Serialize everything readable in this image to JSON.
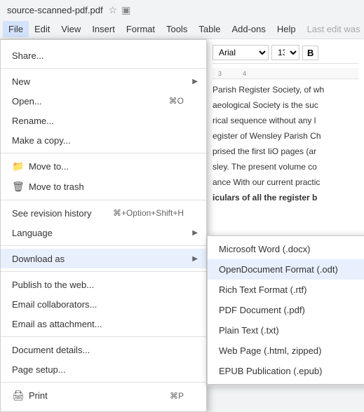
{
  "titleBar": {
    "filename": "source-scanned-pdf.pdf",
    "starIcon": "☆",
    "folderIcon": "▣"
  },
  "menuBar": {
    "items": [
      {
        "label": "File",
        "active": true
      },
      {
        "label": "Edit",
        "active": false
      },
      {
        "label": "View",
        "active": false
      },
      {
        "label": "Insert",
        "active": false
      },
      {
        "label": "Format",
        "active": false
      },
      {
        "label": "Tools",
        "active": false
      },
      {
        "label": "Table",
        "active": false
      },
      {
        "label": "Add-ons",
        "active": false
      },
      {
        "label": "Help",
        "active": false
      },
      {
        "label": "Last edit was",
        "active": false,
        "disabled": true
      }
    ]
  },
  "fileMenu": {
    "sections": [
      {
        "items": [
          {
            "label": "Share...",
            "shortcut": ""
          }
        ]
      },
      {
        "items": [
          {
            "label": "New",
            "hasArrow": true
          },
          {
            "label": "Open...",
            "shortcut": "⌘O"
          },
          {
            "label": "Rename..."
          },
          {
            "label": "Make a copy..."
          }
        ]
      },
      {
        "items": [
          {
            "label": "Move to...",
            "icon": "folder"
          },
          {
            "label": "Move to trash",
            "icon": "trash"
          }
        ]
      },
      {
        "items": [
          {
            "label": "See revision history",
            "shortcut": "⌘+Option+Shift+H"
          },
          {
            "label": "Language",
            "hasArrow": true
          }
        ]
      },
      {
        "items": [
          {
            "label": "Download as",
            "hasArrow": true,
            "highlighted": true
          }
        ]
      },
      {
        "items": [
          {
            "label": "Publish to the web..."
          },
          {
            "label": "Email collaborators..."
          },
          {
            "label": "Email as attachment..."
          }
        ]
      },
      {
        "items": [
          {
            "label": "Document details..."
          },
          {
            "label": "Page setup..."
          }
        ]
      },
      {
        "items": [
          {
            "label": "Print",
            "icon": "print",
            "shortcut": "⌘P"
          }
        ]
      }
    ]
  },
  "downloadSubmenu": {
    "items": [
      {
        "label": "Microsoft Word (.docx)"
      },
      {
        "label": "OpenDocument Format (.odt)",
        "highlighted": true
      },
      {
        "label": "Rich Text Format (.rtf)"
      },
      {
        "label": "PDF Document (.pdf)"
      },
      {
        "label": "Plain Text (.txt)"
      },
      {
        "label": "Web Page (.html, zipped)"
      },
      {
        "label": "EPUB Publication (.epub)"
      }
    ]
  },
  "toolbar": {
    "font": "Arial",
    "fontSize": "13",
    "boldLabel": "B"
  },
  "ruler": {
    "marks": [
      "3",
      "4"
    ]
  },
  "docContent": {
    "lines": [
      "Parish Register Society, of wh",
      "aeological Society is the suc",
      "rical sequence without any l",
      "egister of Wensley Parish Ch",
      "prised the first IiO pages (ar",
      "sley. The present volume co",
      "ance With our current practic",
      "iculars of all the register b"
    ],
    "boldLineIndex": 7
  }
}
